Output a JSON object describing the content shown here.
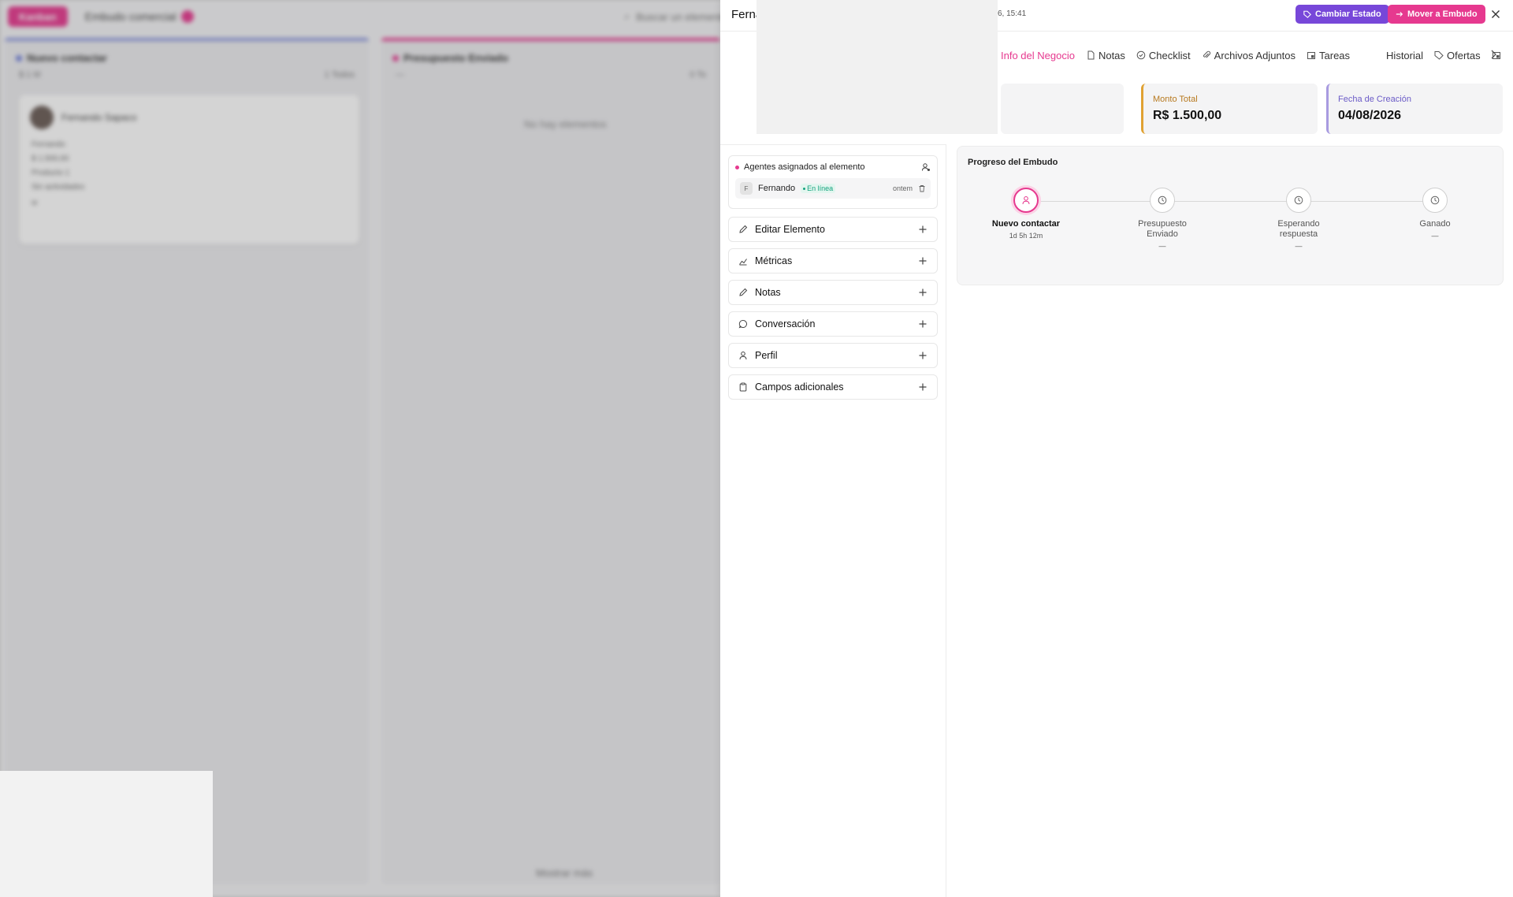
{
  "background": {
    "new_button": "Kanban",
    "funnel_name": "Embudo comercial",
    "search_placeholder": "Buscar un elemento",
    "columns": [
      {
        "name": "Nuevo contactar",
        "sub": "$ 1 M",
        "right": "1 Todos",
        "color": "#6b7bd8"
      },
      {
        "name": "Presupuesto Enviado",
        "sub": "—",
        "right": "0 To",
        "color": "#e6398f"
      }
    ],
    "card": {
      "name": "Fernando Sapaco",
      "lines": [
        "Fernando",
        "$ 1.500,00",
        "Producto 1",
        "Sin actividades",
        "w"
      ]
    },
    "empty": "No hay elementos",
    "show_more": "Mostrar más"
  },
  "panel": {
    "title": "Ferna",
    "time": "6, 15:41",
    "cambiar_label": "Cambiar Estado",
    "mover_label": "Mover a Embudo",
    "tabs": [
      {
        "label": "Info del Negocio",
        "icon": "",
        "active": true
      },
      {
        "label": "Notas",
        "icon": "file-icon"
      },
      {
        "label": "Checklist",
        "icon": "check-circle-icon"
      },
      {
        "label": "Archivos Adjuntos",
        "icon": "paperclip-icon"
      },
      {
        "label": "Tareas",
        "icon": "calendar-task-icon"
      },
      {
        "label": "Historial",
        "icon": ""
      },
      {
        "label": "Ofertas",
        "icon": "tag-icon"
      }
    ],
    "stats": {
      "monto_label": "Monto Total",
      "monto_value": "R$ 1.500,00",
      "fecha_label": "Fecha de Creación",
      "fecha_value": "04/08/2026"
    },
    "agents": {
      "title": "Agentes asignados al elemento",
      "agent_initial": "F",
      "agent_name": "Fernando",
      "agent_status": "En línea",
      "agent_time": "ontem"
    },
    "accordions": [
      {
        "label": "Editar Elemento",
        "icon": "pencil-icon"
      },
      {
        "label": "Métricas",
        "icon": "chart-icon"
      },
      {
        "label": "Notas",
        "icon": "pencil-icon"
      },
      {
        "label": "Conversación",
        "icon": "chat-icon"
      },
      {
        "label": "Perfil",
        "icon": "user-icon"
      },
      {
        "label": "Campos adicionales",
        "icon": "clipboard-icon"
      }
    ],
    "progress": {
      "title": "Progreso del Embudo",
      "stages": [
        {
          "name": "Nuevo contactar",
          "time": "1d 5h 12m",
          "active": true
        },
        {
          "name": "Presupuesto Enviado",
          "time": "—",
          "active": false
        },
        {
          "name": "Esperando respuesta",
          "time": "—",
          "active": false
        },
        {
          "name": "Ganado",
          "time": "—",
          "active": false
        }
      ]
    }
  },
  "colors": {
    "accent_pink": "#e6398f",
    "accent_purple": "#7747d9",
    "monto_border": "#e0a233",
    "fecha_border": "#a89be0"
  }
}
